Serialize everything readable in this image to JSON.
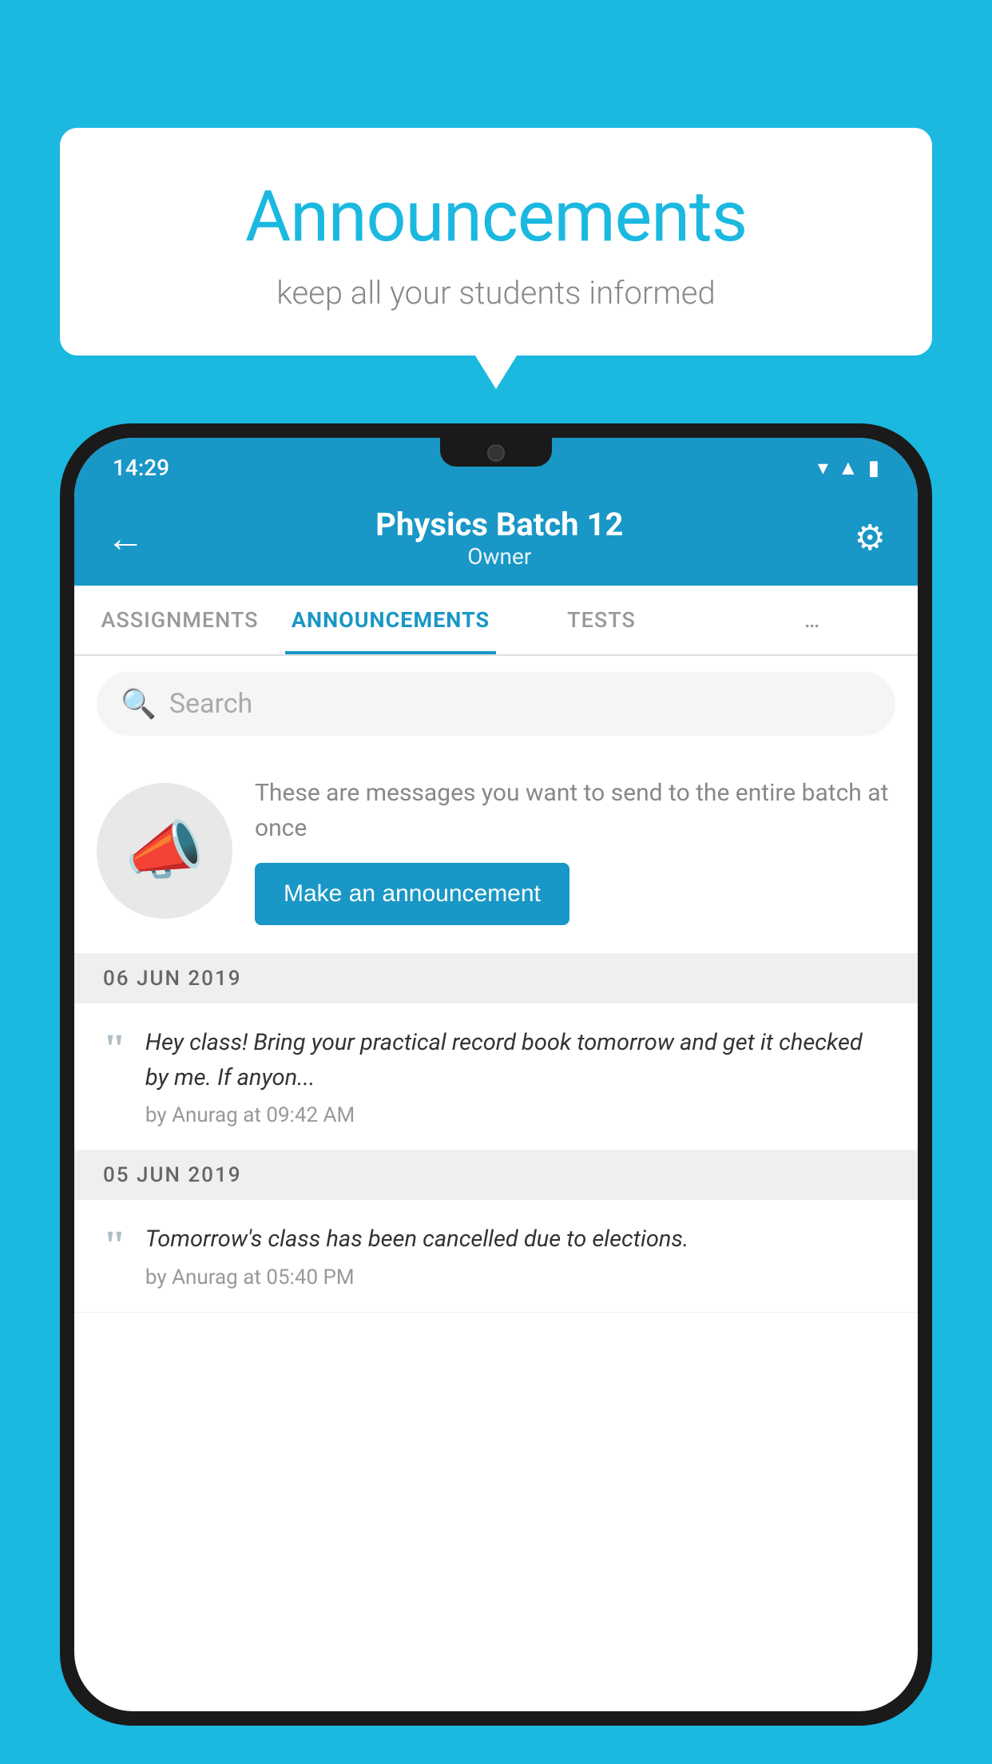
{
  "background_color": "#1bb8e0",
  "speech_bubble": {
    "title": "Announcements",
    "subtitle": "keep all your students informed"
  },
  "status_bar": {
    "time": "14:29",
    "icons": [
      "wifi",
      "signal",
      "battery"
    ]
  },
  "header": {
    "title": "Physics Batch 12",
    "subtitle": "Owner",
    "back_label": "←",
    "settings_label": "⚙"
  },
  "tabs": [
    {
      "label": "ASSIGNMENTS",
      "active": false
    },
    {
      "label": "ANNOUNCEMENTS",
      "active": true
    },
    {
      "label": "TESTS",
      "active": false
    },
    {
      "label": "…",
      "active": false
    }
  ],
  "search": {
    "placeholder": "Search"
  },
  "promo": {
    "description": "These are messages you want to send to the entire batch at once",
    "button_label": "Make an announcement"
  },
  "announcements": [
    {
      "date": "06  JUN  2019",
      "text": "Hey class! Bring your practical record book tomorrow and get it checked by me. If anyon...",
      "meta": "by Anurag at 09:42 AM"
    },
    {
      "date": "05  JUN  2019",
      "text": "Tomorrow's class has been cancelled due to elections.",
      "meta": "by Anurag at 05:40 PM"
    }
  ]
}
